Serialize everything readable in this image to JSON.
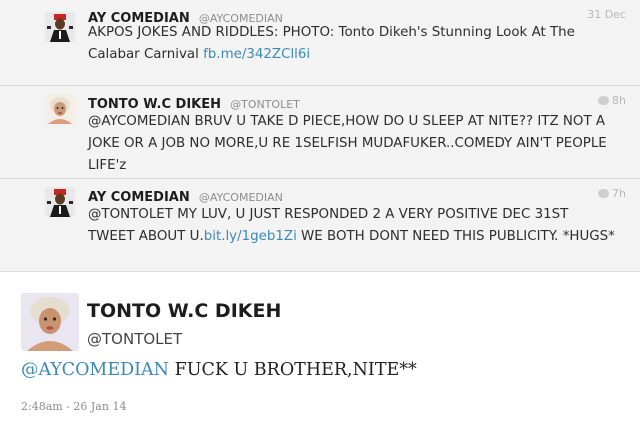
{
  "timeline": [
    {
      "name": "AY COMEDIAN",
      "handle": "@AYCOMEDIAN",
      "time": "31 Dec",
      "text_parts": [
        "AKPOS JOKES AND RIDDLES: PHOTO: Tonto Dikeh's Stunning Look At The Calabar Carnival ",
        "fb.me/342ZCll6i"
      ]
    },
    {
      "name": "TONTO W.C DIKEH",
      "handle": "@TONTOLET",
      "time": "8h",
      "text_parts": [
        "@AYCOMEDIAN BRUV U TAKE D PIECE,HOW DO U SLEEP AT NITE?? ITZ NOT A JOKE OR A JOB NO MORE,U RE 1SELFISH MUDAFUKER..COMEDY AIN'T PEOPLE LIFE'z"
      ]
    },
    {
      "name": "AY COMEDIAN",
      "handle": "@AYCOMEDIAN",
      "time": "7h",
      "text_parts": [
        "@TONTOLET MY LUV, U JUST RESPONDED 2 A VERY POSITIVE DEC 31ST TWEET ABOUT U.",
        "bit.ly/1geb1Zi",
        " WE BOTH DONT NEED THIS PUBLICITY. *HUGS*"
      ]
    }
  ],
  "expanded": {
    "name": "TONTO W.C DIKEH",
    "handle": "@TONTOLET",
    "mention": "@AYCOMEDIAN",
    "text": " FUCK U BROTHER,NITE**",
    "timestamp": "2:48am - 26 Jan 14"
  },
  "colors": {
    "link": "#3a8ab8",
    "row_bg": "#f3f3f3"
  },
  "icons": [
    "reply-bubble-icon"
  ]
}
